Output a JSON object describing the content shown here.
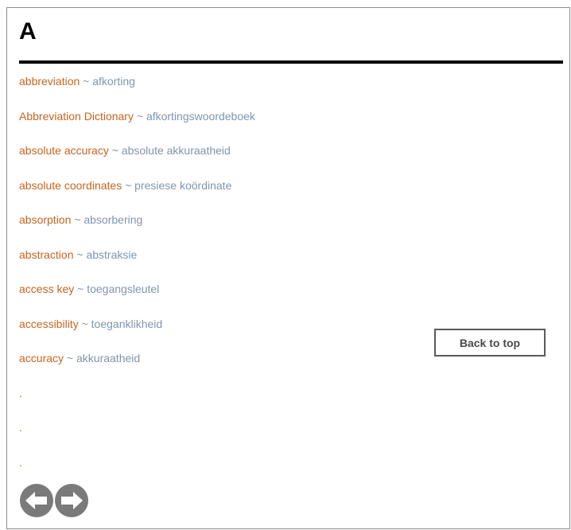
{
  "section": {
    "letter": "A"
  },
  "entries": [
    {
      "term": "abbreviation",
      "separator": "~",
      "translation": "afkorting"
    },
    {
      "term": "Abbreviation Dictionary",
      "separator": "~",
      "translation": "afkortingswoordeboek"
    },
    {
      "term": "absolute accuracy",
      "separator": "~",
      "translation": "absolute akkuraatheid"
    },
    {
      "term": "absolute coordinates",
      "separator": "~",
      "translation": "presiese koördinate"
    },
    {
      "term": "absorption",
      "separator": "~",
      "translation": "absorbering"
    },
    {
      "term": "abstraction",
      "separator": "~",
      "translation": "abstraksie"
    },
    {
      "term": "access key",
      "separator": "~",
      "translation": "toegangsleutel"
    },
    {
      "term": "accessibility",
      "separator": "~",
      "translation": "toeganklikheid"
    },
    {
      "term": "accuracy",
      "separator": "~",
      "translation": "akkuraatheid"
    }
  ],
  "ellipsis": [
    ".",
    ".",
    "."
  ],
  "back_to_top": {
    "label": "Back to top"
  },
  "navigation": {
    "previous_icon": "left-arrow-circle-icon",
    "next_icon": "right-arrow-circle-icon"
  },
  "colors": {
    "term": "#c8641e",
    "translation": "#7f96ad",
    "nav_icon": "#7a7a7a"
  }
}
